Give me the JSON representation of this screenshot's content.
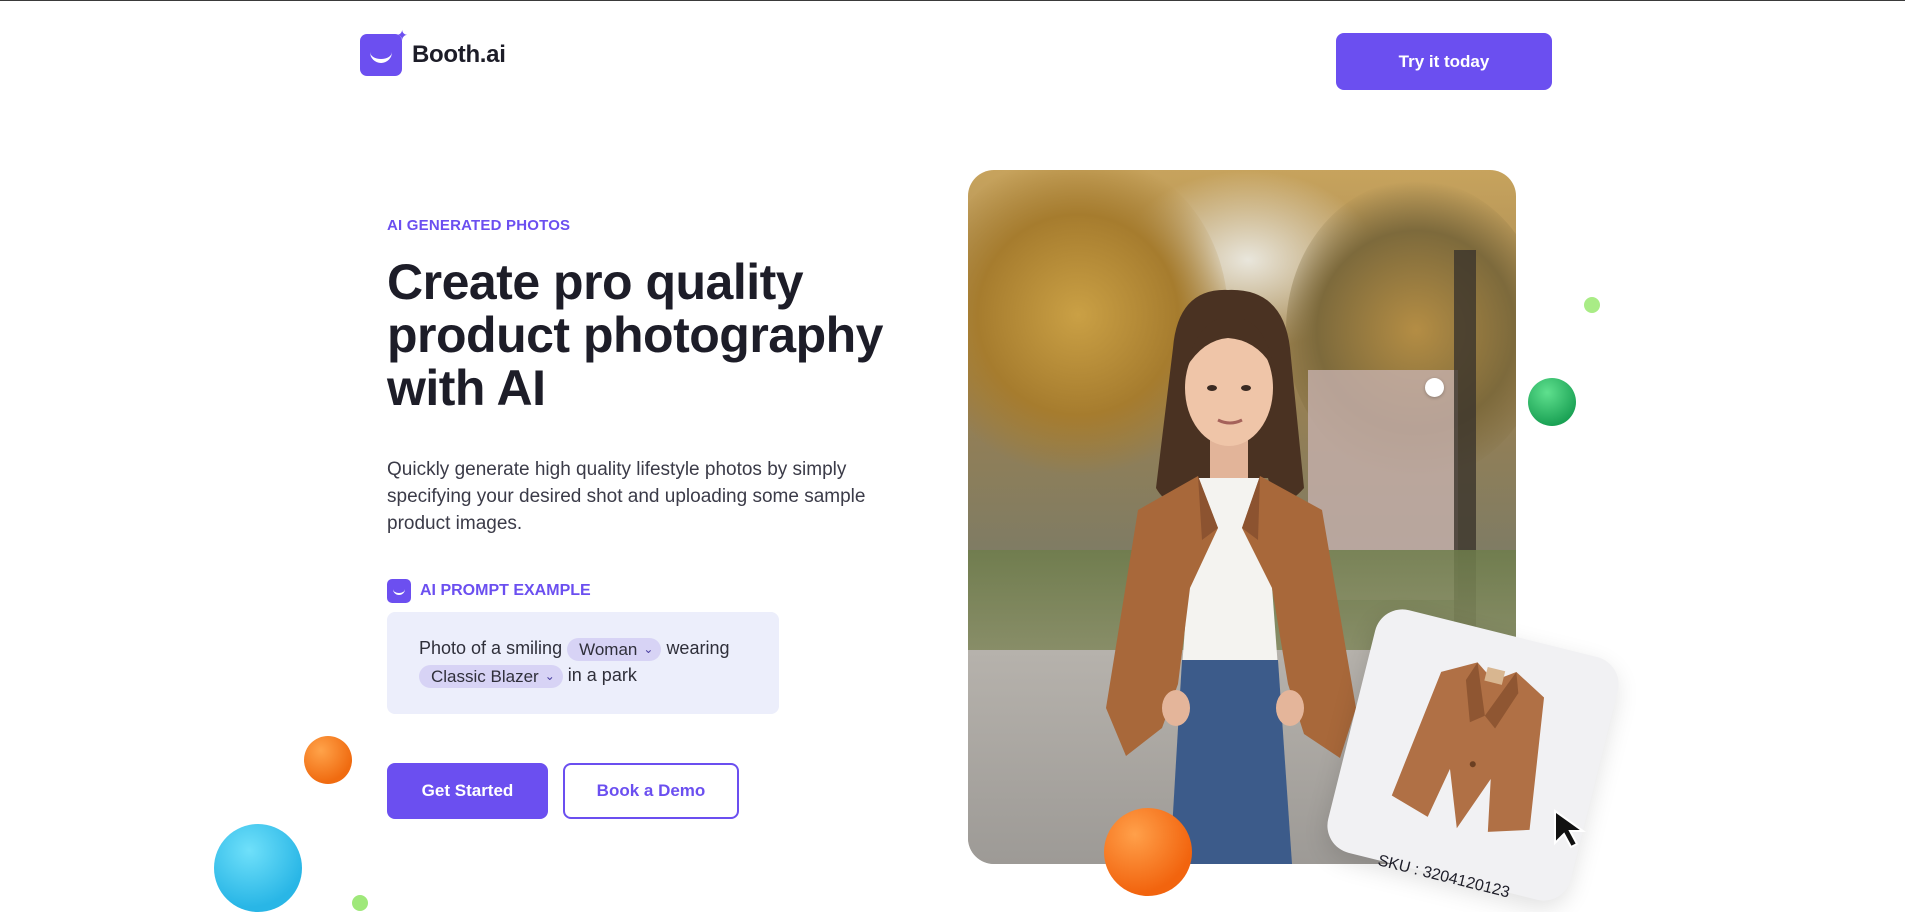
{
  "header": {
    "brand_name": "Booth.ai",
    "cta_label": "Try it today"
  },
  "hero": {
    "eyebrow": "AI GENERATED PHOTOS",
    "headline_lines": [
      "Create pro quality",
      "product photography",
      "with AI"
    ],
    "description": "Quickly generate high quality lifestyle photos by simply specifying your desired shot and uploading some sample product images.",
    "prompt_example": {
      "label": "AI PROMPT EXAMPLE",
      "text_1": "Photo of a smiling",
      "chip_subject": "Woman",
      "text_2": "wearing",
      "chip_product": "Classic Blazer",
      "text_3": "in a park"
    },
    "primary_button": "Get Started",
    "secondary_button": "Book a Demo"
  },
  "product_card": {
    "sku": "SKU : 3204120123"
  },
  "colors": {
    "brand": "#6b4ff0",
    "prompt_bg": "#eceefb",
    "chip_bg": "#d7d3f5"
  },
  "icons": [
    "logo-smile-icon",
    "sparkle-icon",
    "prompt-smile-icon",
    "chevron-down-icon",
    "mouse-cursor-icon"
  ]
}
